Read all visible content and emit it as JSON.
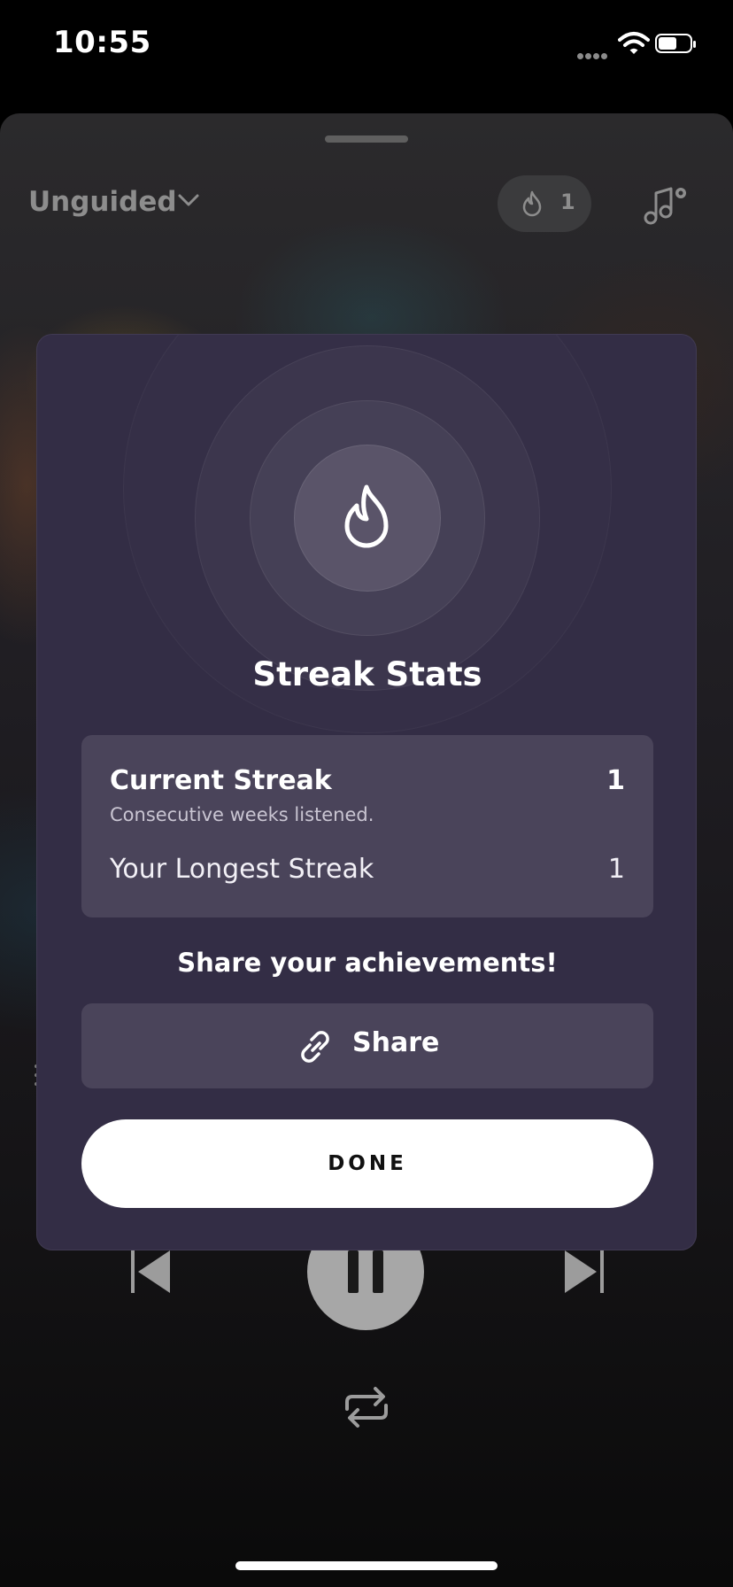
{
  "status_bar": {
    "time": "10:55"
  },
  "player": {
    "mode_label": "Unguided",
    "streak_count": "1"
  },
  "modal": {
    "title": "Streak Stats",
    "current_streak_label": "Current Streak",
    "current_streak_value": "1",
    "current_streak_sub": "Consecutive weeks listened.",
    "longest_streak_label": "Your Longest Streak",
    "longest_streak_value": "1",
    "share_heading": "Share your achievements!",
    "share_label": "Share",
    "done_label": "DONE"
  },
  "icons": [
    "flame-icon",
    "chevron-down-icon",
    "music-settings-icon",
    "link-icon",
    "previous-icon",
    "pause-icon",
    "next-icon",
    "repeat-icon",
    "wifi-icon",
    "battery-icon"
  ],
  "colors": {
    "modal_bg": "#332d45",
    "card_bg": "#4a445a",
    "button_primary": "#ffffff"
  }
}
